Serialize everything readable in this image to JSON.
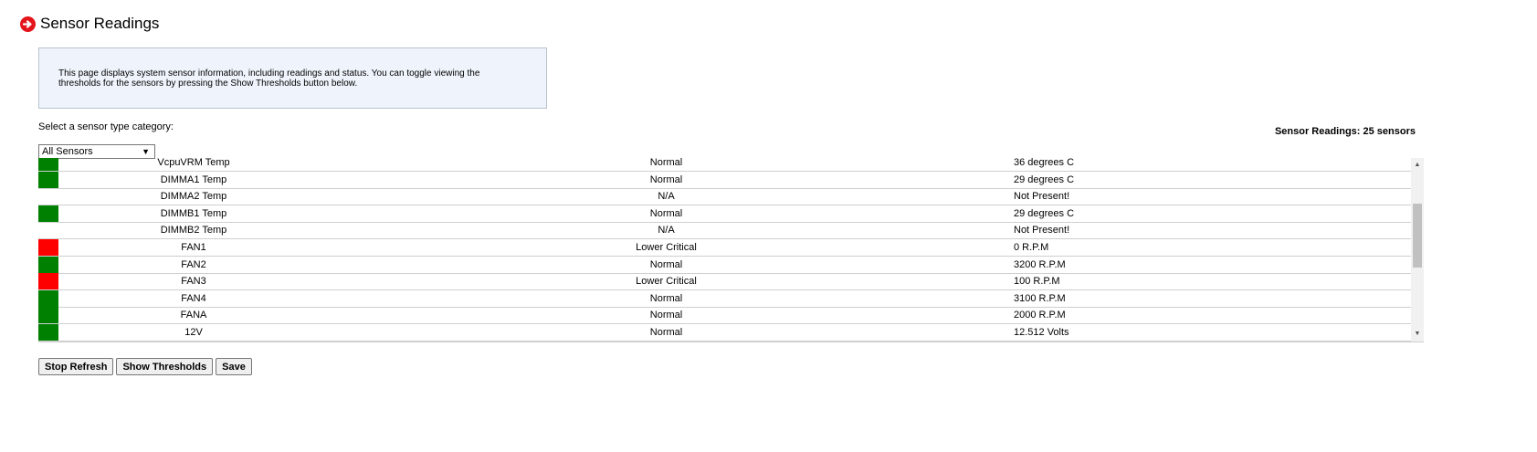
{
  "header": {
    "title": "Sensor Readings",
    "icon": "arrow-right-circle-icon",
    "icon_color": "#e4141b"
  },
  "info": {
    "text": "This page displays system sensor information, including readings and status. You can toggle viewing the thresholds for the sensors by pressing the Show Thresholds button below."
  },
  "category": {
    "label": "Select a sensor type category:",
    "selected": "All Sensors"
  },
  "summary": {
    "count_text": "Sensor Readings: 25 sensors"
  },
  "sensors": [
    {
      "status": "green",
      "name": "VcpuVRM Temp",
      "state": "Normal",
      "reading": "36 degrees C"
    },
    {
      "status": "green",
      "name": "DIMMA1 Temp",
      "state": "Normal",
      "reading": "29 degrees C"
    },
    {
      "status": "none",
      "name": "DIMMA2 Temp",
      "state": "N/A",
      "reading": "Not Present!"
    },
    {
      "status": "green",
      "name": "DIMMB1 Temp",
      "state": "Normal",
      "reading": "29 degrees C"
    },
    {
      "status": "none",
      "name": "DIMMB2 Temp",
      "state": "N/A",
      "reading": "Not Present!"
    },
    {
      "status": "red",
      "name": "FAN1",
      "state": "Lower Critical",
      "reading": "0 R.P.M"
    },
    {
      "status": "green",
      "name": "FAN2",
      "state": "Normal",
      "reading": "3200 R.P.M"
    },
    {
      "status": "red",
      "name": "FAN3",
      "state": "Lower Critical",
      "reading": "100 R.P.M"
    },
    {
      "status": "green",
      "name": "FAN4",
      "state": "Normal",
      "reading": "3100 R.P.M"
    },
    {
      "status": "green",
      "name": "FANA",
      "state": "Normal",
      "reading": "2000 R.P.M"
    },
    {
      "status": "green",
      "name": "12V",
      "state": "Normal",
      "reading": "12.512 Volts"
    }
  ],
  "buttons": {
    "stop_refresh": "Stop Refresh",
    "show_thresholds": "Show Thresholds",
    "save": "Save"
  },
  "colors": {
    "status_green": "#008000",
    "status_red": "#ff0000",
    "info_background": "#eff4fc"
  }
}
